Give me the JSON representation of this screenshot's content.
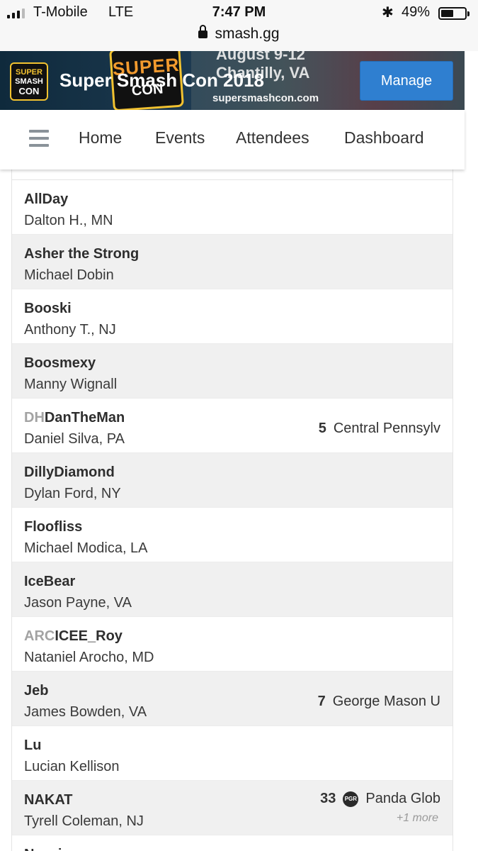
{
  "status_bar": {
    "carrier": "T-Mobile",
    "network": "LTE",
    "time": "7:47 PM",
    "battery": "49%",
    "battery_level": 0.49,
    "url": "smash.gg"
  },
  "banner": {
    "logo_small": [
      "SUPER",
      "SMASH",
      "CON"
    ],
    "logo_big": [
      "SUPER",
      "CON"
    ],
    "dates": "August 9-12",
    "city": "Chantilly, VA",
    "site": "supersmashcon.com",
    "title": "Super Smash Con 2018",
    "manage_label": "Manage"
  },
  "nav": {
    "home": "Home",
    "events": "Events",
    "attendees": "Attendees",
    "dashboard": "Dashboard"
  },
  "attendees": [
    {
      "prefix": "",
      "tag": "AllDay",
      "name": "Dalton H., MN",
      "count": "",
      "team": "",
      "more": ""
    },
    {
      "prefix": "",
      "tag": "Asher the Strong",
      "name": "Michael Dobin",
      "count": "",
      "team": "",
      "more": ""
    },
    {
      "prefix": "",
      "tag": "Booski",
      "name": "Anthony T., NJ",
      "count": "",
      "team": "",
      "more": ""
    },
    {
      "prefix": "",
      "tag": "Boosmexy",
      "name": "Manny Wignall",
      "count": "",
      "team": "",
      "more": ""
    },
    {
      "prefix": "DH",
      "tag": "DanTheMan",
      "name": "Daniel Silva, PA",
      "count": "5",
      "team": "Central Pennsylv",
      "more": ""
    },
    {
      "prefix": "",
      "tag": "DillyDiamond",
      "name": "Dylan Ford, NY",
      "count": "",
      "team": "",
      "more": ""
    },
    {
      "prefix": "",
      "tag": "Floofliss",
      "name": "Michael Modica, LA",
      "count": "",
      "team": "",
      "more": ""
    },
    {
      "prefix": "",
      "tag": "IceBear",
      "name": "Jason Payne, VA",
      "count": "",
      "team": "",
      "more": ""
    },
    {
      "prefix": "ARC",
      "tag": "ICEE_Roy",
      "name": "Nataniel Arocho, MD",
      "count": "",
      "team": "",
      "more": ""
    },
    {
      "prefix": "",
      "tag": "Jeb",
      "name": "James Bowden, VA",
      "count": "7",
      "team": "George Mason U",
      "more": ""
    },
    {
      "prefix": "",
      "tag": "Lu",
      "name": "Lucian Kellison",
      "count": "",
      "team": "",
      "more": ""
    },
    {
      "prefix": "",
      "tag": "NAKAT",
      "name": "Tyrell Coleman, NJ",
      "count": "33",
      "team": "Panda Glob",
      "team_icon": "PGR",
      "more": "+1 more"
    },
    {
      "prefix": "",
      "tag": "Neyxio",
      "name": "",
      "count": "",
      "team": "",
      "more": ""
    }
  ]
}
